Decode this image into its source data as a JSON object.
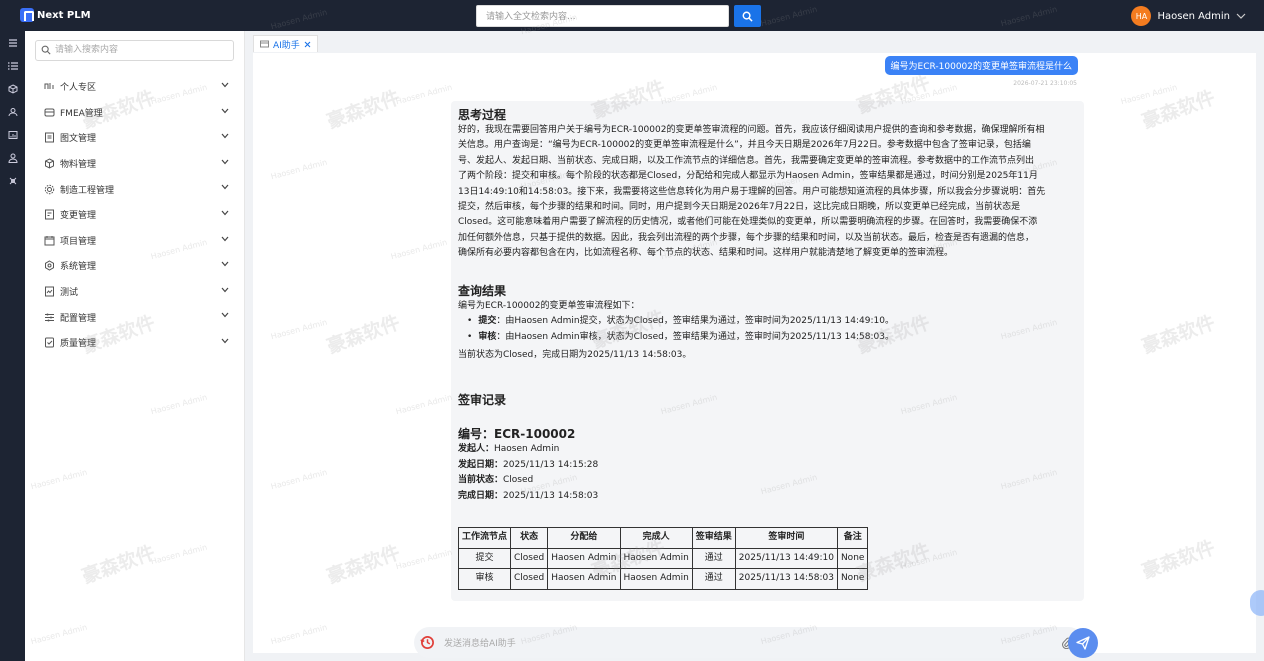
{
  "app": {
    "name": "Next PLM"
  },
  "header": {
    "search_placeholder": "请输入全文检索内容...",
    "user_initials": "HA",
    "user_name": "Haosen Admin"
  },
  "sidebar": {
    "search_placeholder": "请输入搜索内容",
    "items": [
      {
        "label": "个人专区",
        "icon": "personal-icon"
      },
      {
        "label": "FMEA管理",
        "icon": "fmea-icon"
      },
      {
        "label": "图文管理",
        "icon": "document-icon"
      },
      {
        "label": "物料管理",
        "icon": "cube-icon"
      },
      {
        "label": "制造工程管理",
        "icon": "gear-icon"
      },
      {
        "label": "变更管理",
        "icon": "change-icon"
      },
      {
        "label": "项目管理",
        "icon": "project-icon"
      },
      {
        "label": "系统管理",
        "icon": "settings-icon"
      },
      {
        "label": "测试",
        "icon": "test-icon"
      },
      {
        "label": "配置管理",
        "icon": "sliders-icon"
      },
      {
        "label": "质量管理",
        "icon": "quality-icon"
      }
    ]
  },
  "tab": {
    "label": "AI助手"
  },
  "chat": {
    "question": "编号为ECR-100002的变更单签审流程是什么",
    "question_time": "2026-07-21 23:10:05",
    "thinking_title": "思考过程",
    "thinking_lines": [
      "好的，我现在需要回答用户关于编号为ECR-100002的变更单签审流程的问题。首先，我应该仔细阅读用户提供的查询和参考数据，确保理解所有相",
      "关信息。用户查询是：“编号为ECR-100002的变更单签审流程是什么”，并且今天日期是2026年7月22日。参考数据中包含了签审记录，包括编",
      "号、发起人、发起日期、当前状态、完成日期，以及工作流节点的详细信息。首先，我需要确定变更单的签审流程。参考数据中的工作流节点列出",
      "了两个阶段：提交和审核。每个阶段的状态都是Closed，分配给和完成人都显示为Haosen Admin，签审结果都是通过，时间分别是2025年11月",
      "13日14:49:10和14:58:03。接下来，我需要将这些信息转化为用户易于理解的回答。用户可能想知道流程的具体步骤，所以我会分步骤说明：首先",
      "提交，然后审核，每个步骤的结果和时间。同时，用户提到今天日期是2026年7月22日，这比完成日期晚，所以变更单已经完成，当前状态是",
      "Closed。这可能意味着用户需要了解流程的历史情况，或者他们可能在处理类似的变更单，所以需要明确流程的步骤。在回答时，我需要确保不添",
      "加任何额外信息，只基于提供的数据。因此，我会列出流程的两个步骤，每个步骤的结果和时间，以及当前状态。最后，检查是否有遗漏的信息，",
      "确保所有必要内容都包含在内，比如流程名称、每个节点的状态、结果和时间。这样用户就能清楚地了解变更单的签审流程。"
    ],
    "result_title": "查询结果",
    "result_intro": "编号为ECR-100002的变更单签审流程如下：",
    "steps": [
      {
        "name": "提交",
        "text": "：由Haosen Admin提交，状态为Closed，签审结果为通过，签审时间为2025/11/13 14:49:10。"
      },
      {
        "name": "审核",
        "text": "：由Haosen Admin审核，状态为Closed，签审结果为通过，签审时间为2025/11/13 14:58:03。"
      }
    ],
    "result_summary": "当前状态为Closed，完成日期为2025/11/13 14:58:03。",
    "record_title": "签审记录",
    "record_no_label": "编号：",
    "record_no": "ECR-100002",
    "fields": [
      {
        "label": "发起人",
        "value": "Haosen Admin"
      },
      {
        "label": "发起日期",
        "value": "2025/11/13 14:15:28"
      },
      {
        "label": "当前状态",
        "value": "Closed"
      },
      {
        "label": "完成日期",
        "value": "2025/11/13 14:58:03"
      }
    ],
    "table": {
      "headers": [
        "工作流节点",
        "状态",
        "分配给",
        "完成人",
        "签审结果",
        "签审时间",
        "备注"
      ],
      "rows": [
        [
          "提交",
          "Closed",
          "Haosen Admin",
          "Haosen Admin",
          "通过",
          "2025/11/13 14:49:10",
          "None"
        ],
        [
          "审核",
          "Closed",
          "Haosen Admin",
          "Haosen Admin",
          "通过",
          "2025/11/13 14:58:03",
          "None"
        ]
      ]
    },
    "input_placeholder": "发送消息给AI助手"
  },
  "watermark": {
    "main": "豪森软件",
    "sub": "Haosen Admin"
  },
  "colors": {
    "topbar": "#1d2433",
    "accent": "#1a73e8",
    "avatar": "#f47c20",
    "bubble": "#3b82f6"
  }
}
